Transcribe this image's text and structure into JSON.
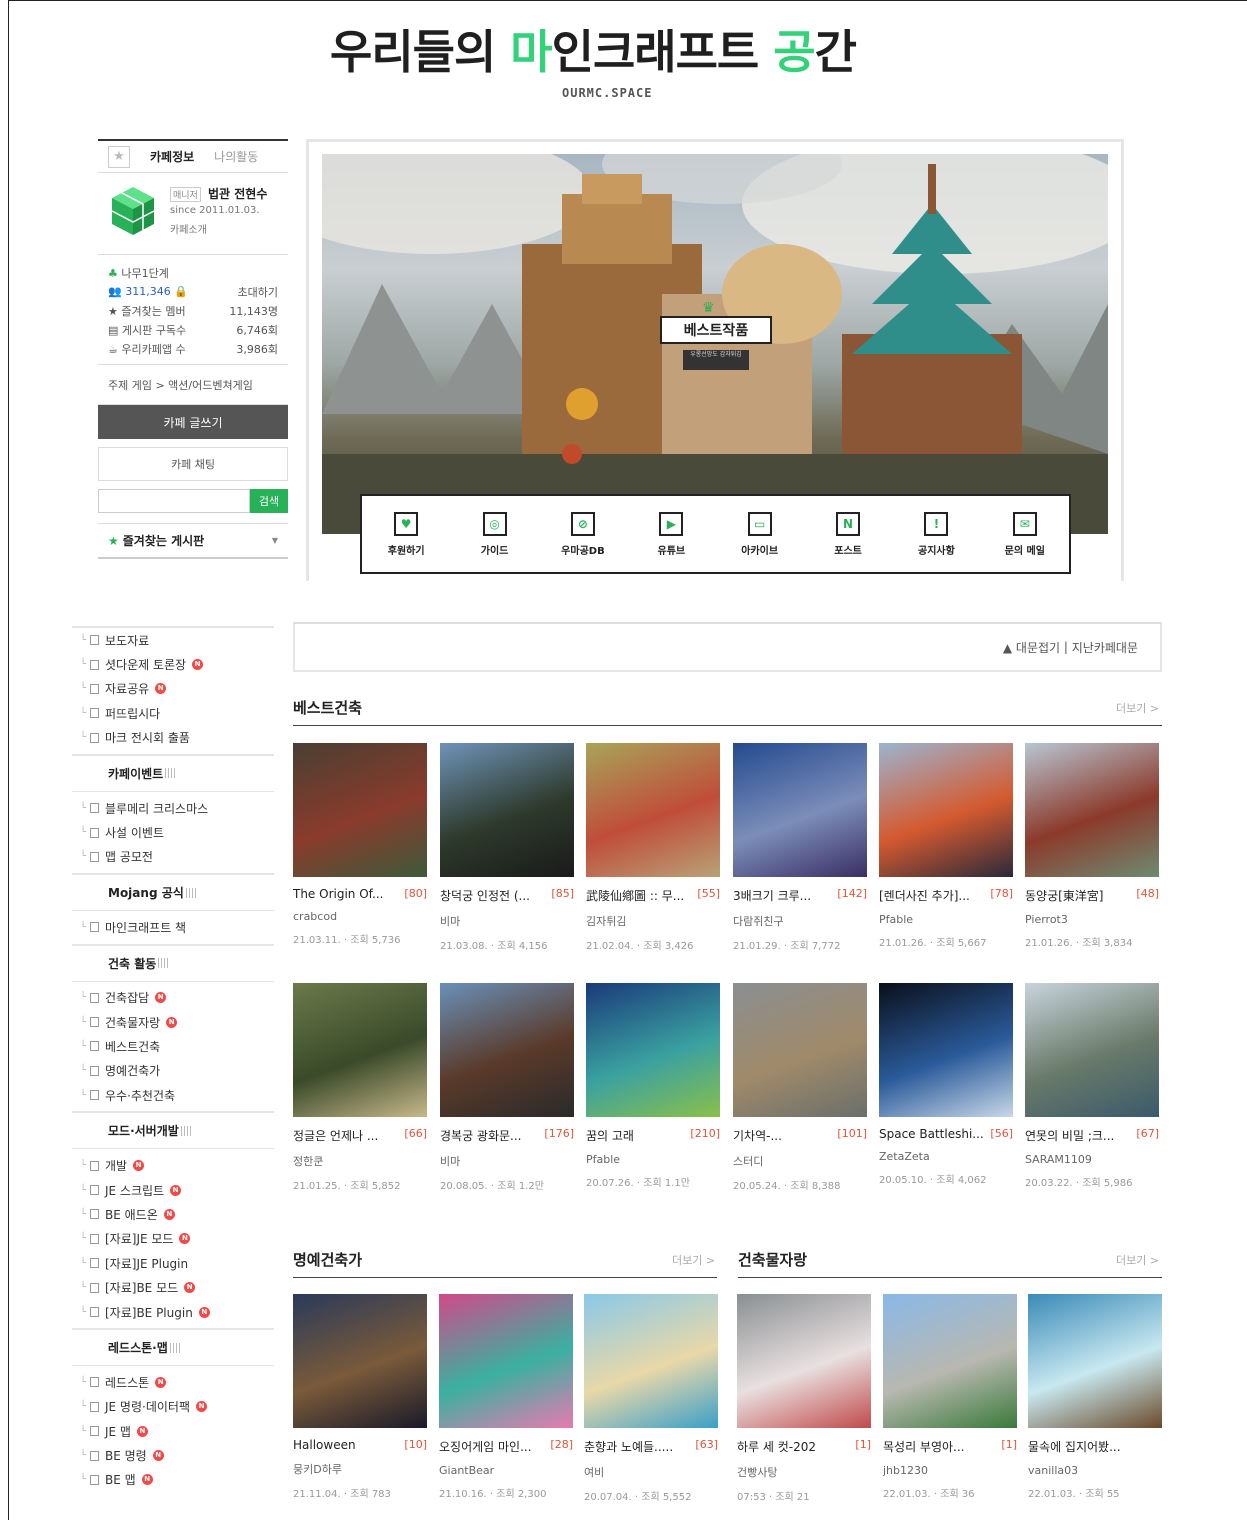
{
  "header": {
    "logo_parts": [
      "우리들의 ",
      "마",
      "인크래프트 ",
      "공",
      "간"
    ],
    "domain": "OURMC.SPACE"
  },
  "sidebar": {
    "tab_info": "카페정보",
    "tab_activity": "나의활동",
    "manager_badge": "매니저",
    "manager_name": "법관 전현수",
    "since": "since 2011.01.03.",
    "intro": "카페소개",
    "level": "나무1단계",
    "members": "311,346",
    "invite": "초대하기",
    "fav_members_label": "즐겨찾는 멤버",
    "fav_members": "11,143명",
    "board_subs_label": "게시판 구독수",
    "board_subs": "6,746회",
    "app_label": "우리카페앱 수",
    "app_count": "3,986회",
    "topic": "주제 게임 > 액션/어드벤쳐게임",
    "write_button": "카페 글쓰기",
    "chat_button": "카페 채팅",
    "search_button": "검색",
    "search_placeholder": "",
    "favorites_label": "즐겨찾는 게시판"
  },
  "hero": {
    "badge": "베스트작품",
    "badge_sub": "우롱선망도 감자튀김",
    "quick_links": [
      {
        "label": "후원하기",
        "icon": "heart-icon"
      },
      {
        "label": "가이드",
        "icon": "compass-icon"
      },
      {
        "label": "우마공DB",
        "icon": "database-icon"
      },
      {
        "label": "유튜브",
        "icon": "play-icon"
      },
      {
        "label": "아카이브",
        "icon": "archive-icon"
      },
      {
        "label": "포스트",
        "icon": "post-icon"
      },
      {
        "label": "공지사항",
        "icon": "notice-icon"
      },
      {
        "label": "문의 메일",
        "icon": "mail-icon"
      }
    ]
  },
  "menu": [
    {
      "type": "item",
      "label": "보도자료",
      "new": false
    },
    {
      "type": "item",
      "label": "셧다운제 토론장",
      "new": true
    },
    {
      "type": "item",
      "label": "자료공유",
      "new": true
    },
    {
      "type": "item",
      "label": "퍼뜨립시다",
      "new": false
    },
    {
      "type": "item",
      "label": "마크 전시회 출품",
      "new": false
    },
    {
      "type": "group",
      "label": "카페이벤트"
    },
    {
      "type": "item",
      "label": "블루메리 크리스마스",
      "new": false
    },
    {
      "type": "item",
      "label": "사설 이벤트",
      "new": false
    },
    {
      "type": "item",
      "label": "맵 공모전",
      "new": false
    },
    {
      "type": "group",
      "label": "Mojang 공식"
    },
    {
      "type": "item",
      "label": "마인크래프트 책",
      "new": false
    },
    {
      "type": "group",
      "label": "건축 활동"
    },
    {
      "type": "item",
      "label": "건축잡담",
      "new": true
    },
    {
      "type": "item",
      "label": "건축물자랑",
      "new": true
    },
    {
      "type": "item",
      "label": "베스트건축",
      "new": false
    },
    {
      "type": "item",
      "label": "명예건축가",
      "new": false
    },
    {
      "type": "item",
      "label": "우수·추천건축",
      "new": false
    },
    {
      "type": "group",
      "label": "모드·서버개발"
    },
    {
      "type": "item",
      "label": "개발",
      "new": true
    },
    {
      "type": "item",
      "label": "JE 스크립트",
      "new": true
    },
    {
      "type": "item",
      "label": "BE 애드온",
      "new": true
    },
    {
      "type": "item",
      "label": "[자료]JE 모드",
      "new": true
    },
    {
      "type": "item",
      "label": "[자료]JE Plugin",
      "new": false
    },
    {
      "type": "item",
      "label": "[자료]BE 모드",
      "new": true
    },
    {
      "type": "item",
      "label": "[자료]BE Plugin",
      "new": true
    },
    {
      "type": "group",
      "label": "레드스톤·맵"
    },
    {
      "type": "item",
      "label": "레드스톤",
      "new": true
    },
    {
      "type": "item",
      "label": "JE 명령·데이터팩",
      "new": true
    },
    {
      "type": "item",
      "label": "JE 맵",
      "new": true
    },
    {
      "type": "item",
      "label": "BE 명령",
      "new": true
    },
    {
      "type": "item",
      "label": "BE 맵",
      "new": true
    }
  ],
  "notice": {
    "fold": "▲ 대문접기",
    "sep": " | ",
    "past": "지난카페대문"
  },
  "best": {
    "title": "베스트건축",
    "more": "더보기 >",
    "cards": [
      {
        "title": "The Origin Of...",
        "count": "[80]",
        "author": "crabcod",
        "meta": "21.03.11. · 조회 5,736",
        "colors": [
          "#4a3f33",
          "#8a3b2c",
          "#3d5a3a"
        ]
      },
      {
        "title": "창덕궁 인정전 (...",
        "count": "[85]",
        "author": "비마",
        "meta": "21.03.08. · 조회 4,156",
        "colors": [
          "#6f93b8",
          "#2e3a2c",
          "#1a1a1a"
        ]
      },
      {
        "title": "武陵仙鄕圖 :: 무...",
        "count": "[55]",
        "author": "김자튀김",
        "meta": "21.02.04. · 조회 3,426",
        "colors": [
          "#a8a45a",
          "#c04d3a",
          "#b8a277"
        ]
      },
      {
        "title": "3배크기 크루...",
        "count": "[142]",
        "author": "다람쥐친구",
        "meta": "21.01.29. · 조회 7,772",
        "colors": [
          "#244a8e",
          "#7c8db9",
          "#3a2f63"
        ]
      },
      {
        "title": "[렌더사진 추가]...",
        "count": "[78]",
        "author": "Pfable",
        "meta": "21.01.26. · 조회 5,667",
        "colors": [
          "#9bb4d0",
          "#d45a2f",
          "#2a2a3a"
        ]
      },
      {
        "title": "동양궁[東洋宮]",
        "count": "[48]",
        "author": "Pierrot3",
        "meta": "21.01.26. · 조회 3,834",
        "colors": [
          "#b8c6d4",
          "#8c3a2a",
          "#6d8b72"
        ]
      },
      {
        "title": "정글은 언제나 ...",
        "count": "[66]",
        "author": "정한쿤",
        "meta": "21.01.25. · 조회 5,852",
        "colors": [
          "#6b7a4a",
          "#3a4a2a",
          "#c8b88a"
        ]
      },
      {
        "title": "경복궁 광화문...",
        "count": "[176]",
        "author": "비마",
        "meta": "20.08.05. · 조회 1.2만",
        "colors": [
          "#6a90b8",
          "#5a3a2a",
          "#2a2a2a"
        ]
      },
      {
        "title": "꿈의 고래",
        "count": "[210]",
        "author": "Pfable",
        "meta": "20.07.26. · 조회 1.1만",
        "colors": [
          "#1a3a7a",
          "#3aa0a0",
          "#8ac04a"
        ]
      },
      {
        "title": "기차역-...",
        "count": "[101]",
        "author": "스터디",
        "meta": "20.05.24. · 조회 8,388",
        "colors": [
          "#8a8f92",
          "#a08a6a",
          "#6a6f6a"
        ]
      },
      {
        "title": "Space Battleshi...",
        "count": "[56]",
        "author": "ZetaZeta",
        "meta": "20.05.10. · 조회 4,062",
        "colors": [
          "#0a0f1a",
          "#2a5a9a",
          "#c8d8e8"
        ]
      },
      {
        "title": "연못의 비밀 ;크...",
        "count": "[67]",
        "author": "SARAM1109",
        "meta": "20.03.22. · 조회 5,986",
        "colors": [
          "#c8d4dc",
          "#6a7a6a",
          "#3a5a6a"
        ]
      }
    ]
  },
  "honor": {
    "title": "명예건축가",
    "more": "더보기 >",
    "cards": [
      {
        "title": "Halloween",
        "count": "[10]",
        "author": "뭉키D하루",
        "meta": "21.11.04. · 조회 783",
        "colors": [
          "#2a3a5a",
          "#7a5a3a",
          "#1a1a2a"
        ]
      },
      {
        "title": "오징어게임 마인...",
        "count": "[28]",
        "author": "GiantBear",
        "meta": "21.10.16. · 조회 2,300",
        "colors": [
          "#d04a8a",
          "#3ab0a0",
          "#e87ab0"
        ]
      },
      {
        "title": "춘향과 노예들.....",
        "count": "[63]",
        "author": "여비",
        "meta": "20.07.04. · 조회 5,552",
        "colors": [
          "#8ac8e8",
          "#e8d8a8",
          "#3aa0c8"
        ]
      }
    ]
  },
  "proud": {
    "title": "건축물자랑",
    "more": "더보기 >",
    "cards": [
      {
        "title": "하루 세 컷-202",
        "count": "[1]",
        "author": "건빵사탕",
        "meta": "07:53 · 조회 21",
        "colors": [
          "#8a8f92",
          "#e8e0e0",
          "#c04a4a"
        ]
      },
      {
        "title": "목성리 부영아...",
        "count": "[1]",
        "author": "jhb1230",
        "meta": "22.01.03. · 조회 36",
        "colors": [
          "#8ab8e8",
          "#b8b8b0",
          "#3a7a3a"
        ]
      },
      {
        "title": "물속에 집지어봤...",
        "count": "",
        "author": "vanilla03",
        "meta": "22.01.03. · 조회 55",
        "colors": [
          "#3a8ab8",
          "#c8e8f0",
          "#6a4a2a"
        ]
      }
    ]
  }
}
